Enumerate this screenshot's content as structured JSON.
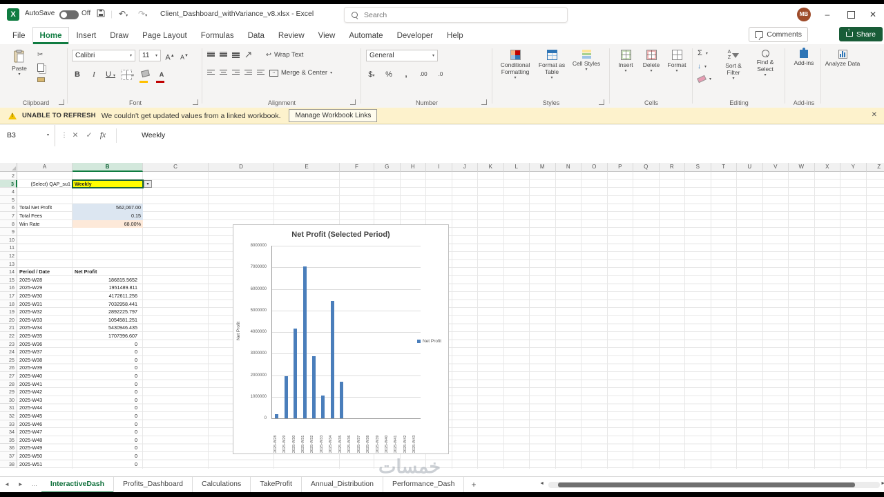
{
  "colors": {
    "excel_green": "#107c41",
    "bar_blue": "#4a7ebb",
    "selection_yellow": "#ffff00",
    "warning_bg": "#fdf2cc",
    "avatar_bg": "#9e4b2a",
    "cf_icon": [
      "#f4b183",
      "#c00000",
      "#9dc3e6",
      "#2e75b6"
    ],
    "styles_icon": [
      "#ffe699",
      "#a9d18e",
      "#9dc3e6"
    ]
  },
  "icons": {
    "excel_logo_letter": "X",
    "dropdown": "▾",
    "close": "✕",
    "check": "✓",
    "cancel": "✕",
    "undo": "↶",
    "redo": "↷",
    "cut": "✂",
    "sigma": "Σ",
    "fill_down": "↓",
    "wrap_return": "↩",
    "merge_arrows": "↔",
    "bold": "B",
    "italic": "I",
    "underline": "U",
    "grow_font": "A",
    "shrink_font": "A",
    "dollar": "$",
    "percent": "%",
    "comma": ",",
    "increase_decimal": ".00",
    "decrease_decimal": ".0",
    "fx": "fx",
    "vdots": "⋮",
    "minimize": "–",
    "back": "◄",
    "forward": "►",
    "ellipsis": "…",
    "plus": "+"
  },
  "titlebar": {
    "autosave_label": "AutoSave",
    "autosave_state": "Off",
    "document_title": "Client_Dashboard_withVariance_v8.xlsx - Excel",
    "search_placeholder": "Search",
    "avatar_initials": "MB"
  },
  "ribbon": {
    "tabs": [
      "File",
      "Home",
      "Insert",
      "Draw",
      "Page Layout",
      "Formulas",
      "Data",
      "Review",
      "View",
      "Automate",
      "Developer",
      "Help"
    ],
    "active_tab": "Home",
    "comments_label": "Comments",
    "share_label": "Share",
    "group_labels": [
      "Clipboard",
      "Font",
      "Alignment",
      "Number",
      "Styles",
      "Cells",
      "Editing",
      "Add-ins"
    ],
    "font_group": {
      "font_name": "Calibri",
      "font_size": "11"
    },
    "number_group": {
      "format": "General"
    },
    "buttons": {
      "paste": "Paste",
      "wrap_text": "Wrap Text",
      "merge_center": "Merge & Center",
      "conditional_formatting": "Conditional Formatting",
      "format_as_table": "Format as Table",
      "cell_styles": "Cell Styles",
      "insert": "Insert",
      "delete": "Delete",
      "format": "Format",
      "sort_filter": "Sort & Filter",
      "find_select": "Find & Select",
      "add_ins": "Add-ins",
      "analyze_data": "Analyze Data"
    }
  },
  "message_bar": {
    "title": "UNABLE TO REFRESH",
    "message": "We couldn't get updated values from a linked workbook.",
    "action_label": "Manage Workbook Links"
  },
  "formula_bar": {
    "name_box": "B3",
    "content": "Weekly"
  },
  "grid": {
    "column_letters": [
      "A",
      "B",
      "C",
      "D",
      "E",
      "F",
      "G",
      "H",
      "I",
      "J",
      "K",
      "L",
      "M",
      "N",
      "O",
      "P",
      "Q",
      "R",
      "S",
      "T",
      "U",
      "V",
      "W",
      "X",
      "Y",
      "Z"
    ],
    "first_row": 2,
    "last_row": 38,
    "selected_column": "B",
    "selected_row": 3,
    "selector": {
      "row": 3,
      "label": "(Select) QAP_su1",
      "value": "Weekly"
    },
    "summary_rows": [
      {
        "row": 6,
        "label": "Total Net Profit",
        "value": "562,067.00",
        "fill": "#dce6f1"
      },
      {
        "row": 7,
        "label": "Total Fees",
        "value": "0.15",
        "fill": "#dce6f1"
      },
      {
        "row": 8,
        "label": "Win Rate",
        "value": "68.00%",
        "fill": "#fde9d9"
      }
    ],
    "table_header": {
      "row": 14,
      "period": "Period / Date",
      "profit": "Net Profit"
    },
    "data_rows": [
      {
        "row": 15,
        "period": "2025-W28",
        "profit": "186815.5652"
      },
      {
        "row": 16,
        "period": "2025-W29",
        "profit": "1951489.811"
      },
      {
        "row": 17,
        "period": "2025-W30",
        "profit": "4172611.256"
      },
      {
        "row": 18,
        "period": "2025-W31",
        "profit": "7032958.441"
      },
      {
        "row": 19,
        "period": "2025-W32",
        "profit": "2892225.797"
      },
      {
        "row": 20,
        "period": "2025-W33",
        "profit": "1054581.251"
      },
      {
        "row": 21,
        "period": "2025-W34",
        "profit": "5430946.435"
      },
      {
        "row": 22,
        "period": "2025-W35",
        "profit": "1707396.607"
      },
      {
        "row": 23,
        "period": "2025-W36",
        "profit": "0"
      },
      {
        "row": 24,
        "period": "2025-W37",
        "profit": "0"
      },
      {
        "row": 25,
        "period": "2025-W38",
        "profit": "0"
      },
      {
        "row": 26,
        "period": "2025-W39",
        "profit": "0"
      },
      {
        "row": 27,
        "period": "2025-W40",
        "profit": "0"
      },
      {
        "row": 28,
        "period": "2025-W41",
        "profit": "0"
      },
      {
        "row": 29,
        "period": "2025-W42",
        "profit": "0"
      },
      {
        "row": 30,
        "period": "2025-W43",
        "profit": "0"
      },
      {
        "row": 31,
        "period": "2025-W44",
        "profit": "0"
      },
      {
        "row": 32,
        "period": "2025-W45",
        "profit": "0"
      },
      {
        "row": 33,
        "period": "2025-W46",
        "profit": "0"
      },
      {
        "row": 34,
        "period": "2025-W47",
        "profit": "0"
      },
      {
        "row": 35,
        "period": "2025-W48",
        "profit": "0"
      },
      {
        "row": 36,
        "period": "2025-W49",
        "profit": "0"
      },
      {
        "row": 37,
        "period": "2025-W50",
        "profit": "0"
      },
      {
        "row": 38,
        "period": "2025-W51",
        "profit": "0"
      }
    ]
  },
  "chart_data": {
    "type": "bar",
    "title": "Net Profit (Selected Period)",
    "ylabel": "Net Profit",
    "legend": [
      "Net Profit"
    ],
    "legend_position": "right",
    "grid": true,
    "categories": [
      "2025-W28",
      "2025-W29",
      "2025-W30",
      "2025-W31",
      "2025-W32",
      "2025-W33",
      "2025-W34",
      "2025-W35",
      "2025-W36",
      "2025-W37",
      "2025-W38",
      "2025-W39",
      "2025-W40",
      "2025-W41",
      "2025-W42",
      "2025-W43"
    ],
    "values": [
      186815.5652,
      1951489.811,
      4172611.256,
      7032958.441,
      2892225.797,
      1054581.251,
      5430946.435,
      1707396.607,
      0,
      0,
      0,
      0,
      0,
      0,
      0,
      0
    ],
    "ylim": [
      0,
      8000000
    ],
    "ytick_step": 1000000
  },
  "sheet_bar": {
    "tabs": [
      "InteractiveDash",
      "Profits_Dashboard",
      "Calculations",
      "TakeProfit",
      "Annual_Distribution",
      "Performance_Dash"
    ],
    "active_tab": "InteractiveDash"
  },
  "watermark": "خمسات"
}
